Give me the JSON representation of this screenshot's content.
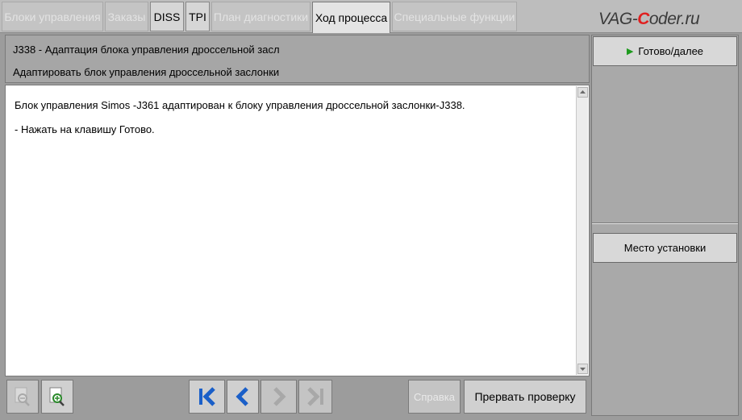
{
  "tabs": [
    {
      "label": "Блоки управления",
      "state": "disabled"
    },
    {
      "label": "Заказы",
      "state": "disabled"
    },
    {
      "label": "DISS",
      "state": "enabled"
    },
    {
      "label": "TPI",
      "state": "enabled"
    },
    {
      "label": "План диагностики",
      "state": "disabled"
    },
    {
      "label": "Ход процесса",
      "state": "active"
    },
    {
      "label": "Специальные функции",
      "state": "disabled"
    }
  ],
  "logo": {
    "part1": "VAG-",
    "part2": "C",
    "part3": "oder.ru",
    "accent_color": "#e02020"
  },
  "header": {
    "line1": "J338 - Адаптация блока управления дроссельной засл",
    "line2": "Адаптировать блок управления дроссельной заслонки"
  },
  "content": {
    "line1": "Блок управления Simos -J361 адаптирован к блоку управления дроссельной заслонки-J338.",
    "line2": "- Нажать на клавишу Готово."
  },
  "toolbar": {
    "zoom_out_icon": "zoom-out-icon",
    "zoom_in_icon": "zoom-in-icon",
    "first_icon": "skip-first-icon",
    "prev_icon": "chevron-left-icon",
    "next_icon": "chevron-right-icon",
    "last_icon": "skip-last-icon",
    "help_label": "Справка",
    "abort_label": "Прервать проверку",
    "nav_color": "#1a5fc8"
  },
  "right_panel": {
    "done_label": "Готово/далее",
    "location_label": "Место установки",
    "play_color": "#1e9a1e"
  }
}
